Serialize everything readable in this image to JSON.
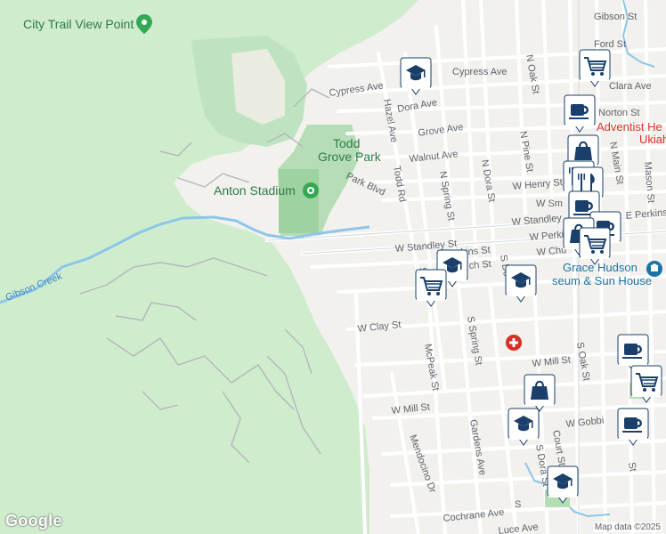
{
  "map": {
    "streets": [
      {
        "id": "gibson-st",
        "text": "Gibson St"
      },
      {
        "id": "ford-st",
        "text": "Ford St"
      },
      {
        "id": "cypress-ave-1",
        "text": "Cypress Ave"
      },
      {
        "id": "cypress-ave-2",
        "text": "Cypress Ave"
      },
      {
        "id": "clara-ave",
        "text": "Clara Ave"
      },
      {
        "id": "n-oak-st",
        "text": "N Oak St"
      },
      {
        "id": "dora-ave",
        "text": "Dora Ave"
      },
      {
        "id": "norton-st",
        "text": "Norton St"
      },
      {
        "id": "hazel-ave",
        "text": "Hazel Ave"
      },
      {
        "id": "grove-ave",
        "text": "Grove Ave"
      },
      {
        "id": "n-pine-st",
        "text": "N Pine St"
      },
      {
        "id": "walnut-ave",
        "text": "Walnut Ave"
      },
      {
        "id": "n-dora-st",
        "text": "N Dora St"
      },
      {
        "id": "todd-rd",
        "text": "Todd Rd"
      },
      {
        "id": "park-blvd",
        "text": "Park Blvd"
      },
      {
        "id": "n-spring-st",
        "text": "N Spring St"
      },
      {
        "id": "w-henry-st",
        "text": "W Henry St"
      },
      {
        "id": "w-sm",
        "text": "W Sm"
      },
      {
        "id": "n-main-st",
        "text": "N Main St"
      },
      {
        "id": "mason-st",
        "text": "Mason St"
      },
      {
        "id": "w-standley-st-1",
        "text": "W Standley St"
      },
      {
        "id": "w-standley-st-2",
        "text": "W Standley"
      },
      {
        "id": "e-perkins-st",
        "text": "E Perkins St"
      },
      {
        "id": "w-perkins-st-1",
        "text": "kins St"
      },
      {
        "id": "w-perkins-st-2",
        "text": "W Perkins"
      },
      {
        "id": "w-church-st",
        "text": "W Chu"
      },
      {
        "id": "s-st-1",
        "text": "S"
      },
      {
        "id": "w-church-2",
        "text": "ch St"
      },
      {
        "id": "s-dora-st-1",
        "text": "S Do"
      },
      {
        "id": "w-clay-st",
        "text": "W Clay St"
      },
      {
        "id": "mcpeak-st",
        "text": "McPeak St"
      },
      {
        "id": "s-spring-st",
        "text": "S Spring St"
      },
      {
        "id": "w-mill-st-1",
        "text": "W Mill St"
      },
      {
        "id": "w-mill-st-2",
        "text": "W Mill St"
      },
      {
        "id": "s-oak-st",
        "text": "S Oak St"
      },
      {
        "id": "w-gobbi",
        "text": "W Gobbi"
      },
      {
        "id": "gardens-ave",
        "text": "Gardens Ave"
      },
      {
        "id": "court-st",
        "text": "Court St"
      },
      {
        "id": "s-dora-st-2",
        "text": "S Dora St"
      },
      {
        "id": "mendocino-dr",
        "text": "Mendocino Dr"
      },
      {
        "id": "cochrane-ave",
        "text": "Cochrane Ave"
      },
      {
        "id": "luce-ave",
        "text": "Luce Ave"
      },
      {
        "id": "s-st-2",
        "text": "S"
      },
      {
        "id": "st-right",
        "text": "St"
      }
    ],
    "labels": {
      "city_trail": "City Trail View Point",
      "todd_grove_1": "Todd",
      "todd_grove_2": "Grove Park",
      "anton_stadium": "Anton Stadium",
      "gibson_creek": "Gibson Creek",
      "grace_hudson_1": "Grace Hudson",
      "grace_hudson_2": "seum & Sun House",
      "adventist_1": "Adventist He",
      "adventist_2": "Ukiah"
    },
    "attribution": "Map data ©2025",
    "logo": "Google",
    "colors": {
      "park": "#c8e6c9",
      "hill": "#d9efd6",
      "road": "#ffffff",
      "water": "#8ec6ea",
      "marker": "#1a3f6b"
    }
  }
}
